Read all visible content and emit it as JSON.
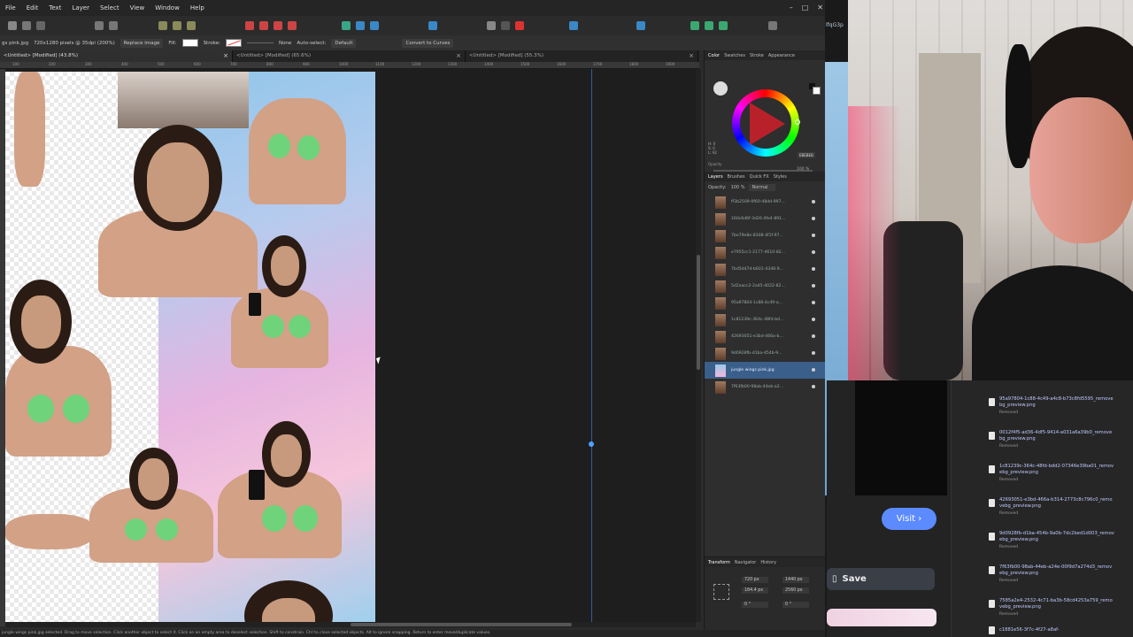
{
  "menu": [
    "File",
    "Edit",
    "Text",
    "Layer",
    "Select",
    "View",
    "Window",
    "Help"
  ],
  "window_controls": [
    "–",
    "□",
    "✕"
  ],
  "context": {
    "doc_name": "gs pink.jpg",
    "doc_info": "720x1280 pixels @ 35dpi (200%)",
    "replace_image": "Replace image",
    "fill_label": "Fill:",
    "stroke_label": "Stroke:",
    "stroke_value": "None",
    "auto_select": "Auto-select:",
    "auto_select_value": "Default",
    "convert_curves": "Convert to Curves"
  },
  "tabs": [
    {
      "label": "<Untitled> [Modified] (43.8%)",
      "active": true
    },
    {
      "label": "<Untitled> [Modified] (65.6%)",
      "active": false
    },
    {
      "label": "<Untitled> [Modified] (55.3%)",
      "active": false
    }
  ],
  "ruler_ticks": [
    "100",
    "200",
    "300",
    "400",
    "500",
    "600",
    "700",
    "800",
    "900",
    "1000",
    "1100",
    "1200",
    "1300",
    "1400",
    "1500",
    "1600",
    "1700",
    "1800",
    "1900"
  ],
  "right_panel": {
    "color_tabs": [
      "Color",
      "Swatches",
      "Stroke",
      "Appearance"
    ],
    "hsl_text": "H: 0\nS: 0\nL: 92",
    "opacity_label": "Opacity",
    "opacity_value": "100 %",
    "hex": "EBEBEB",
    "layer_tabs": [
      "Layers",
      "Brushes",
      "Quick FX",
      "Styles"
    ],
    "layer_opacity_label": "Opacity:",
    "layer_opacity_value": "100 %",
    "blend_mode": "Normal",
    "layers": [
      "ff3b2509-0f60-48dd-997...",
      "160c6d6f-3d26-4fe4-891...",
      "7be79e8e-8308-4f1f-97...",
      "e7955cc1-2177-4610-82...",
      "7bd5d47d-b601-4348-9...",
      "5d2aacc2-2a45-4022-82...",
      "95a97804-1c88-4c49-a...",
      "1c81239c-364c-48fd-bd...",
      "42693051-e3bd-466a-b...",
      "9d0928fb-d1ba-454b-9...",
      "jungle wings pink.jpg",
      "7f63fb00-98ab-44eb-a2..."
    ],
    "selected_layer": 10,
    "transform_tabs": [
      "Transform",
      "Navigator",
      "History"
    ],
    "transform": {
      "x": "720 px",
      "y": "184.4 px",
      "w": "1440 px",
      "h": "2560 px",
      "r": "0 °",
      "s": "0 °"
    }
  },
  "status_text": "jungle wings pink.jpg selected. Drag to move selection. Click another object to select it. Click on an empty area to deselect selection. Shift to constrain. Ctrl to close selected objects. Alt to ignore snapping. Return to enter move/duplicate values.",
  "strip_text": "lfqG3p",
  "browser": {
    "visit_label": "Visit",
    "save_label": "Save",
    "downloads": [
      {
        "name": "95a97804-1c88-4c49-a4c8-b73c8fd5595_removebg_preview.png",
        "status": "Removed"
      },
      {
        "name": "0012f4f5-ad36-4df5-9414-a031a6a39b0_removebg_preview.png",
        "status": "Removed"
      },
      {
        "name": "1c81239c-364c-48fd-bdd2-07346e39ba01_removebg_preview.png",
        "status": "Removed"
      },
      {
        "name": "42693051-e3bd-466a-b314-2773c8c796c0_removebg_preview.png",
        "status": "Removed"
      },
      {
        "name": "9d0928fb-d1ba-454b-9a0b-7dc2bed1d003_removebg_preview.png",
        "status": "Removed"
      },
      {
        "name": "7f63fb00-98ab-44eb-a24e-00f9d7a274d3_removebg_preview.png",
        "status": "Removed"
      },
      {
        "name": "7585a2e4-2532-4c71-ba3b-58cd4253a759_removebg_preview.png",
        "status": "Removed"
      },
      {
        "name": "c1881e56-3f7c-4f27-a8af-",
        "status": ""
      }
    ]
  },
  "colors": {
    "accent": "#3a5f8a",
    "bikini": "#6ed37a",
    "visit": "#5b8bff"
  }
}
